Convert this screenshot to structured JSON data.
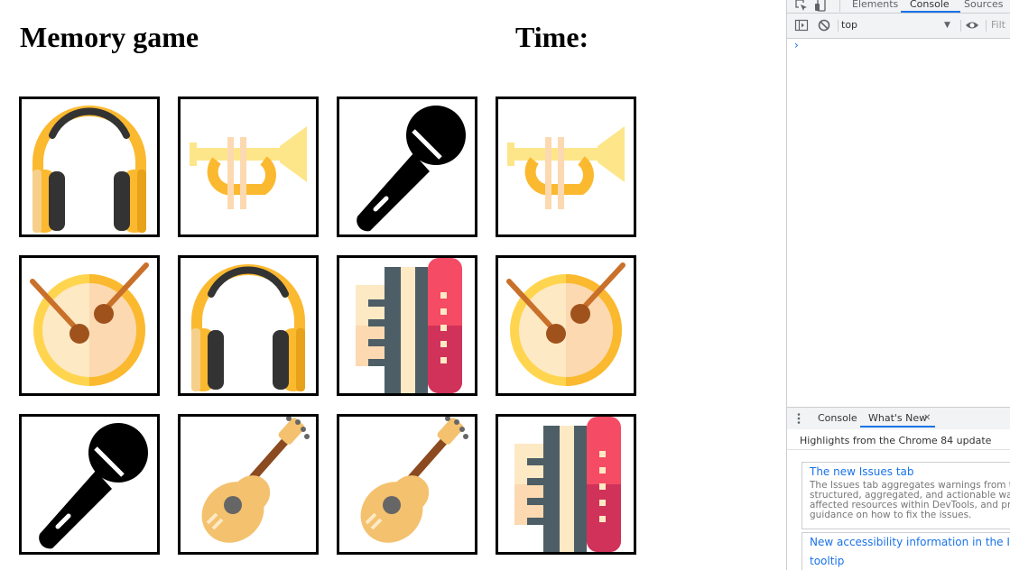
{
  "game": {
    "title": "Memory game",
    "time_label": "Time:",
    "cards": [
      {
        "icon": "headphones-icon"
      },
      {
        "icon": "trumpet-icon"
      },
      {
        "icon": "microphone-icon"
      },
      {
        "icon": "trumpet-icon"
      },
      {
        "icon": "drum-icon"
      },
      {
        "icon": "headphones-icon"
      },
      {
        "icon": "accordion-icon"
      },
      {
        "icon": "drum-icon"
      },
      {
        "icon": "microphone-icon"
      },
      {
        "icon": "guitar-icon"
      },
      {
        "icon": "guitar-icon"
      },
      {
        "icon": "accordion-icon"
      }
    ]
  },
  "devtools": {
    "tabs": {
      "elements": "Elements",
      "console": "Console",
      "sources": "Sources"
    },
    "active_tab": "Console",
    "toolbar": {
      "context": "top",
      "filter_placeholder": "Filt"
    },
    "console_prompt": "›",
    "drawer": {
      "tabs": {
        "console": "Console",
        "whats_new": "What's New"
      },
      "close_symbol": "✕",
      "highlights": "Highlights from the Chrome 84 update",
      "items": [
        {
          "title": "The new Issues tab",
          "desc_lines": [
            "The Issues tab aggregates warnings from th",
            "structured, aggregated, and actionable way",
            "affected resources within DevTools, and pro",
            "guidance on how to fix the issues."
          ]
        },
        {
          "title_line1": "New accessibility information in the Insp",
          "title_line2": "tooltip"
        }
      ]
    }
  },
  "colors": {
    "accent_blue": "#1a73e8",
    "card_border": "#000000",
    "trumpet": "#fdd94b",
    "drum_rim": "#ffd54f",
    "guitar_body": "#f4c16e",
    "accordion_red": "#f54b64"
  }
}
